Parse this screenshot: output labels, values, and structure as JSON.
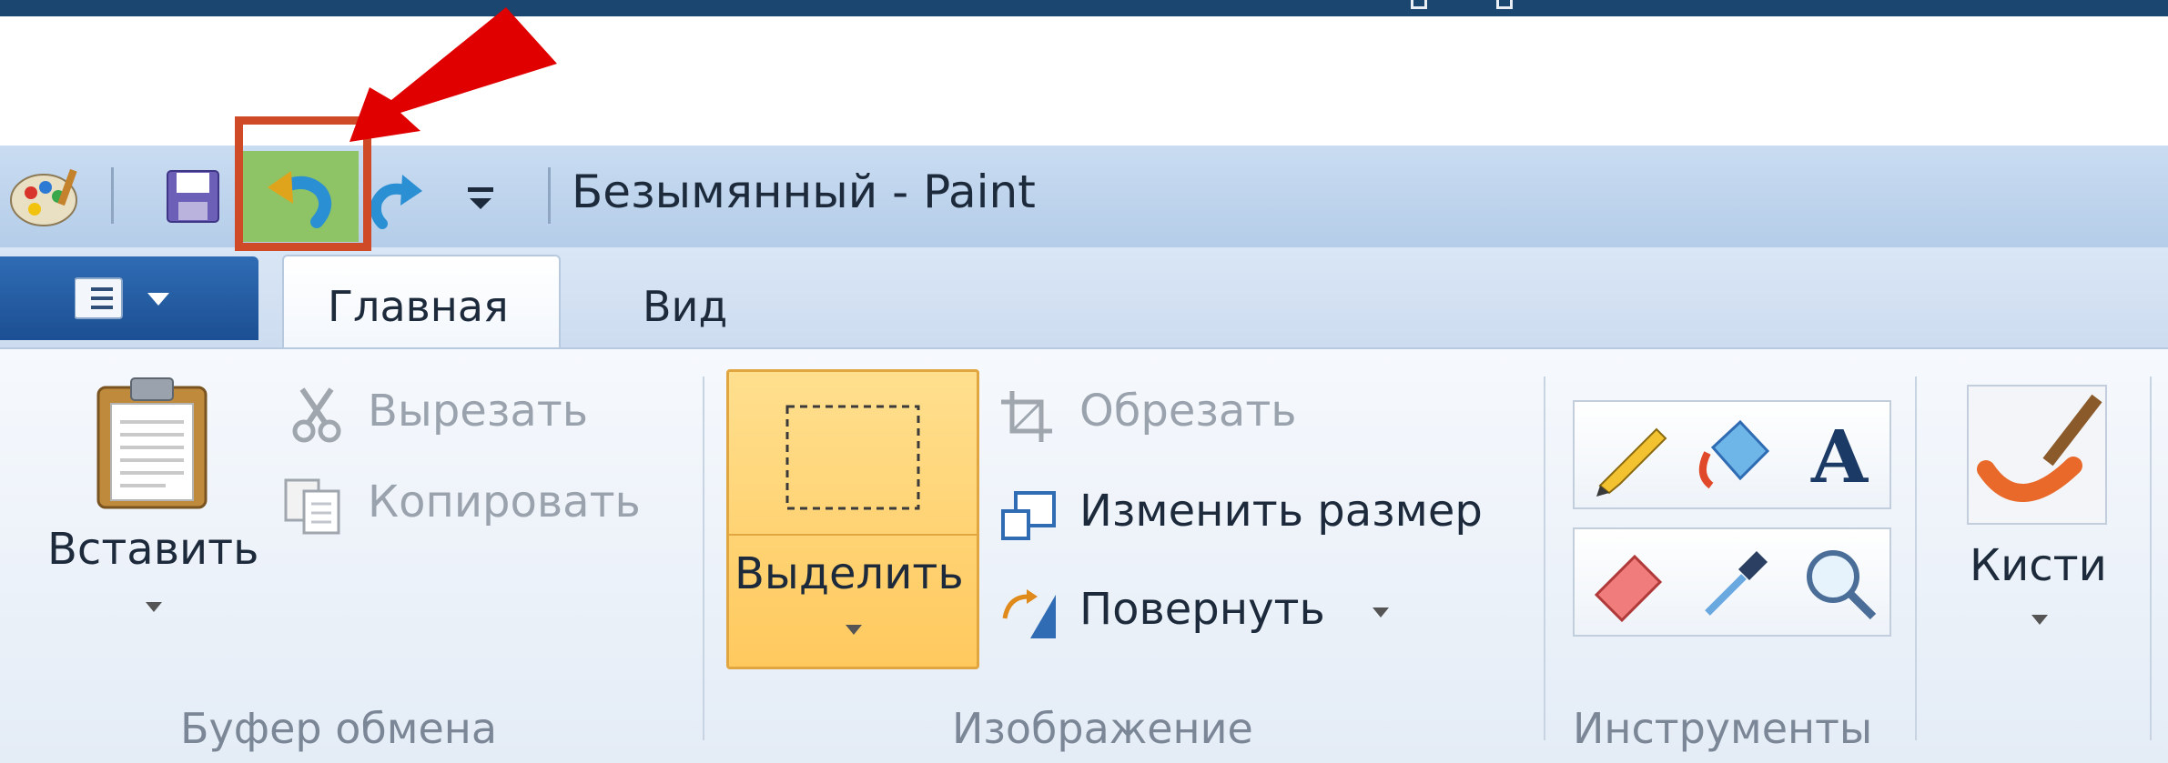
{
  "window": {
    "title": "Безымянный - Paint"
  },
  "tabs": {
    "home": "Главная",
    "view": "Вид"
  },
  "clipboard": {
    "paste": "Вставить",
    "cut": "Вырезать",
    "copy": "Копировать",
    "group": "Буфер обмена"
  },
  "image": {
    "select": "Выделить",
    "crop": "Обрезать",
    "resize": "Изменить размер",
    "rotate": "Повернуть",
    "group": "Изображение"
  },
  "tools": {
    "group": "Инструменты"
  },
  "brushes": {
    "label": "Кисти"
  },
  "colors": {
    "accent": "#f1c15c",
    "highlight": "#cf4a27",
    "arrow": "#e00000",
    "topbar": "#1b4670"
  }
}
